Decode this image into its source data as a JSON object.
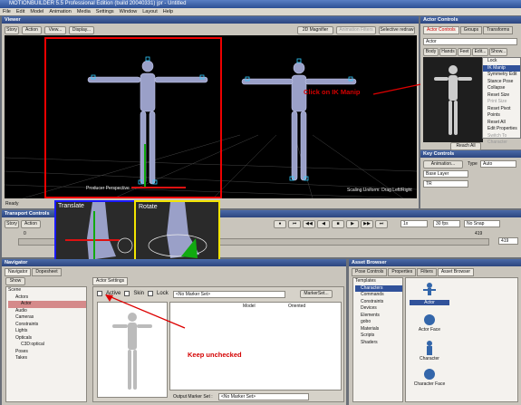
{
  "window": {
    "title": "MOTIONBUILDER 5.5 Professional Edition (build 20040331) jpr - Untitled"
  },
  "menu": [
    "File",
    "Edit",
    "Model",
    "Animation",
    "Media",
    "Settings",
    "Window",
    "Layout",
    "Help"
  ],
  "viewer": {
    "title": "Viewer",
    "story": "Story",
    "action": "Action",
    "view": "View...",
    "display": "Display...",
    "magnifier": "2D Magnifier",
    "anim_filters": "Animation Filters",
    "selective": "Selective redraw",
    "status": "Ready",
    "scaling": "Scaling:Uniform: Drag Left/Right",
    "producer": "Producer Perspective"
  },
  "actor_controls": {
    "title": "Actor Controls",
    "tabs": [
      "Actor Controls",
      "Groups",
      "Transforms"
    ],
    "name": "Actor",
    "buttons": [
      "Body",
      "Hands",
      "Feet",
      "Edit...",
      "Show..."
    ],
    "menu": [
      "Lock",
      "IK Manip",
      "Symmetry Edit",
      "Stance Pose",
      "Collapse",
      "Reset Size",
      "Print Size",
      "Reset Pivot Points",
      "Reset All",
      "Edit Properties",
      "Switch To Character"
    ],
    "reach": "Reach All"
  },
  "annotations": {
    "ik": "Click on IK Manip",
    "keep": "Keep unchecked",
    "translate": "Translate",
    "rotate": "Rotate"
  },
  "key_controls": {
    "title": "Key Controls",
    "animation": "Animation...",
    "type": "Type",
    "type_val": "Auto",
    "base": "Base Layer",
    "tr": "TR"
  },
  "transport": {
    "title": "Transport Controls",
    "story": "Story",
    "action": "Action",
    "fps": "30 fps",
    "snap": "No Snap",
    "speed": "1x",
    "start": "0",
    "end": "419",
    "frame": "419"
  },
  "navigator": {
    "title": "Navigator",
    "tabs": [
      "Navigator",
      "Dopesheet"
    ],
    "show": "Show",
    "settings": "Actor Settings",
    "active": "Active",
    "skin": "Skin",
    "lock": "Lock",
    "marker": "<No Marker Set>",
    "marker_btn": "MarkerSet...",
    "col_model": "Model",
    "col_oriented": "Oriented",
    "output": "Output Marker Set :",
    "output_val": "<No Marker Set>"
  },
  "tree": [
    "Scene",
    "Actors",
    "Actor",
    "Audio",
    "Cameras",
    "Constraints",
    "Lights",
    "Opticals",
    "C3D:optical",
    "Poses",
    "Takes"
  ],
  "asset": {
    "title": "Asset Browser",
    "tabs": [
      "Pose Controls",
      "Properties",
      "Filters",
      "Asset Browser"
    ],
    "tree": [
      "Templates",
      "Characters",
      "Commands",
      "Constraints",
      "Devices",
      "Elements",
      "gobo",
      "Materials",
      "Scripts",
      "Shaders"
    ],
    "items": [
      "Actor",
      "Actor Face",
      "Character",
      "Character Face"
    ]
  }
}
